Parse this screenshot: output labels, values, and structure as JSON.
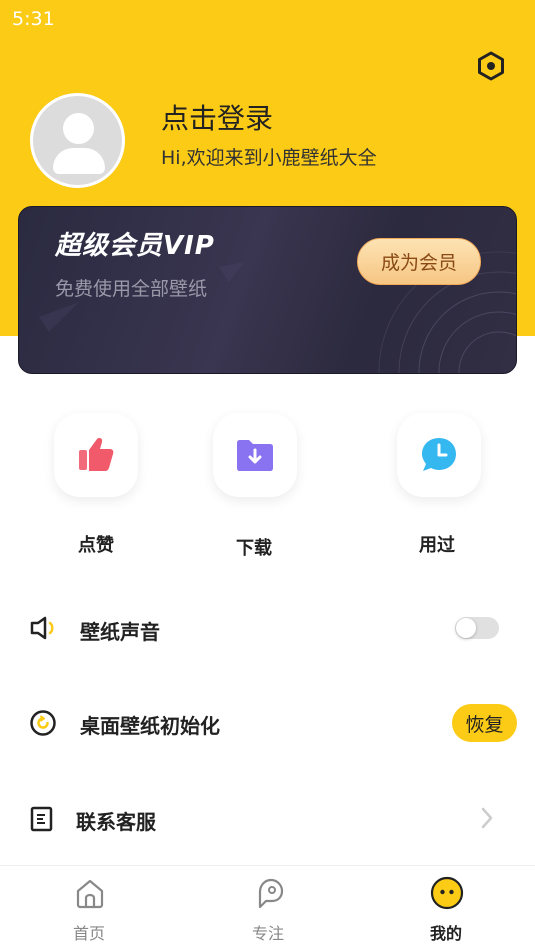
{
  "status_bar": {
    "time": "5:31"
  },
  "header": {
    "login_title": "点击登录",
    "login_subtitle": "Hi,欢迎来到小鹿壁纸大全",
    "settings_icon": "hexagon-settings-icon"
  },
  "vip_card": {
    "title": "超级会员VIP",
    "subtitle": "免费使用全部壁纸",
    "button_label": "成为会员"
  },
  "quick_actions": [
    {
      "label": "点赞",
      "icon": "thumbs-up-icon",
      "color": "#f05a6a"
    },
    {
      "label": "下载",
      "icon": "download-folder-icon",
      "color": "#8a73f0"
    },
    {
      "label": "用过",
      "icon": "clock-bubble-icon",
      "color": "#35b8f0"
    }
  ],
  "settings": {
    "sound": {
      "label": "壁纸声音",
      "icon": "speaker-icon",
      "enabled": false
    },
    "reset": {
      "label": "桌面壁纸初始化",
      "icon": "reset-icon",
      "button_label": "恢复"
    },
    "support": {
      "label": "联系客服",
      "icon": "document-icon"
    }
  },
  "bottom_nav": [
    {
      "label": "首页",
      "icon": "home-icon",
      "active": false
    },
    {
      "label": "专注",
      "icon": "ghost-icon",
      "active": false
    },
    {
      "label": "我的",
      "icon": "smiley-face-icon",
      "active": true
    }
  ],
  "colors": {
    "accent": "#fccb16",
    "vip_card_bg": "#2e2b42",
    "vip_button": "#f6c684"
  }
}
